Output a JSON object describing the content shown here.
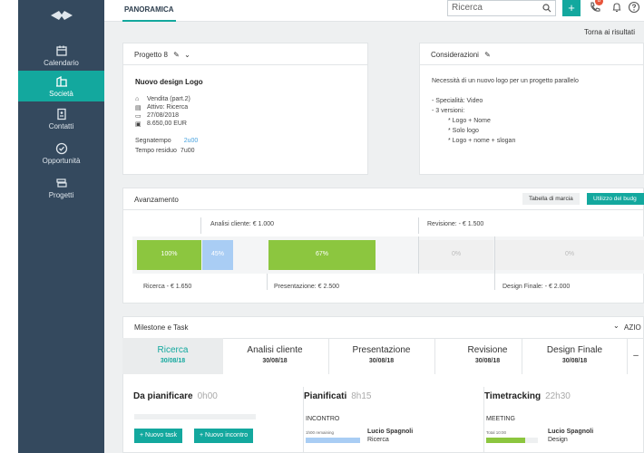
{
  "sidebar": {
    "items": [
      {
        "label": "Calendario"
      },
      {
        "label": "Società"
      },
      {
        "label": "Contatti"
      },
      {
        "label": "Opportunità"
      },
      {
        "label": "Progetti"
      }
    ]
  },
  "topbar": {
    "tab": "PANORAMICA",
    "search_placeholder": "Ricerca",
    "plus": "+",
    "badge": "8"
  },
  "back_link": "Torna ai risultati",
  "project": {
    "header": "Progetto 8",
    "name": "Nuovo design Logo",
    "meta": [
      "Vendita (part.2)",
      "Attivo: Ricerca",
      "27/08/2018",
      "8.650,00 EUR"
    ],
    "segnatempo_label": "Segnatempo",
    "segnatempo_value": "2u00",
    "residuo_label": "Tempo residuo",
    "residuo_value": "7u00"
  },
  "considerazioni": {
    "header": "Considerazioni",
    "text": "Necessità di un nuovo logo per un progetto parallelo",
    "lines": [
      "- Specialità: Video",
      "- 3 versioni:",
      "* Logo + Nome",
      "* Solo logo",
      "* Logo + nome + slogan"
    ]
  },
  "avanzamento": {
    "header": "Avanzamento",
    "btn_tabella": "Tabella di marcia",
    "btn_utilizzo": "Utilizzo del budg",
    "top_labels": [
      "Analisi cliente: € 1.000",
      "Revisione: - € 1.500"
    ],
    "bottom_labels": [
      "Ricerca - € 1.650",
      "Presentazione: € 2.500",
      "Design Finale: - € 2.000"
    ],
    "bars": [
      {
        "text": "100%",
        "value": 100,
        "color": "#8cc63f"
      },
      {
        "text": "45%",
        "value": 45,
        "color": "#a9cdf4"
      },
      {
        "text": "67%",
        "value": 67,
        "color": "#8cc63f"
      },
      {
        "text": "0%",
        "value": 0,
        "color": "#f0f0f0"
      },
      {
        "text": "0%",
        "value": 0,
        "color": "#f0f0f0"
      }
    ]
  },
  "milestone": {
    "header": "Milestone e Task",
    "azioni": "AZIO",
    "tabs": [
      {
        "name": "Ricerca",
        "date": "30/08/18"
      },
      {
        "name": "Analisi cliente",
        "date": "30/08/18"
      },
      {
        "name": "Presentazione",
        "date": "30/08/18"
      },
      {
        "name": "Revisione",
        "date": "30/08/18"
      },
      {
        "name": "Design Finale",
        "date": "30/08/18"
      }
    ],
    "col1": {
      "title": "Da pianificare",
      "hours": "0h00"
    },
    "col2": {
      "title": "Pianificati",
      "hours": "8h15",
      "section": "INCONTRO",
      "remaining": "1h00 remaining",
      "person": "Lucio Spagnoli",
      "role": "Ricerca"
    },
    "col3": {
      "title": "Timetracking",
      "hours": "22h30",
      "section": "MEETING",
      "total": "Total 10:00",
      "person": "Lucio Spagnoli",
      "role": "Design"
    },
    "btn_task": "+ Nuovo task",
    "btn_incontro": "+ Nuovo incontro"
  },
  "colors": {
    "accent": "#13a89e",
    "sidebar": "#34495e",
    "green": "#8cc63f",
    "blue": "#a9cdf4"
  }
}
